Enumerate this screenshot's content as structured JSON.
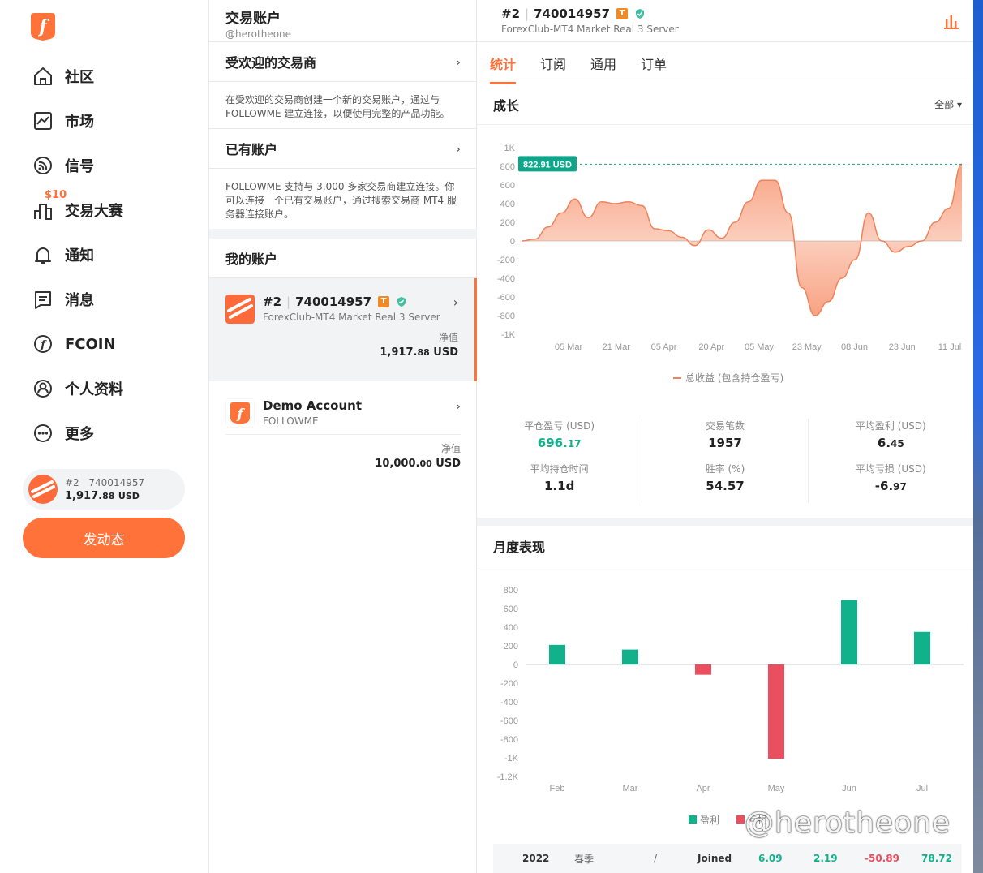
{
  "sidebar": {
    "items": [
      {
        "label": "社区",
        "icon": "home-icon"
      },
      {
        "label": "市场",
        "icon": "chart-icon"
      },
      {
        "label": "信号",
        "icon": "signal-icon"
      },
      {
        "label": "交易大赛",
        "icon": "contest-icon",
        "badge": "$10"
      },
      {
        "label": "通知",
        "icon": "bell-icon"
      },
      {
        "label": "消息",
        "icon": "message-icon"
      },
      {
        "label": "FCOIN",
        "icon": "fcoin-icon"
      },
      {
        "label": "个人资料",
        "icon": "profile-icon"
      },
      {
        "label": "更多",
        "icon": "more-icon"
      }
    ],
    "account_pill": {
      "num": "#2",
      "id": "740014957",
      "balance_main": "1,917.",
      "balance_dec": "88",
      "currency": "USD"
    },
    "post_button": "发动态",
    "accent": "#ff7239"
  },
  "middle": {
    "title": "交易账户",
    "handle": "@herotheone",
    "popular_title": "受欢迎的交易商",
    "popular_desc": "在受欢迎的交易商创建一个新的交易账户，通过与 FOLLOWME 建立连接，以便使用完整的产品功能。",
    "existing_title": "已有账户",
    "existing_desc": "FOLLOWME 支持与 3,000 多家交易商建立连接。你可以连接一个已有交易账户，通过搜索交易商 MT4 服务器连接账户。",
    "my_accounts_title": "我的账户",
    "accounts": [
      {
        "num": "#2",
        "id": "740014957",
        "server": "ForexClub-MT4 Market Real 3 Server",
        "equity_label": "净值",
        "equity_main": "1,917.",
        "equity_dec": "88",
        "currency": "USD",
        "badge": "T"
      },
      {
        "name": "Demo Account",
        "server": "FOLLOWME",
        "equity_label": "净值",
        "equity_main": "10,000.",
        "equity_dec": "00",
        "currency": "USD"
      }
    ]
  },
  "right": {
    "num": "#2",
    "id": "740014957",
    "badge": "T",
    "server": "ForexClub-MT4 Market Real 3 Server",
    "tabs": [
      "统计",
      "订阅",
      "通用",
      "订单"
    ],
    "growth_title": "成长",
    "filter": "全部",
    "stats": [
      {
        "label": "平仓盈亏 (USD)",
        "main": "696.",
        "dec": "17"
      },
      {
        "label": "平均持仓时间",
        "value": "1.1d"
      },
      {
        "label": "交易笔数",
        "value": "1957"
      },
      {
        "label": "胜率 (%)",
        "value": "54.57"
      },
      {
        "label": "平均盈利 (USD)",
        "main": "6.",
        "dec": "45"
      },
      {
        "label": "平均亏损 (USD)",
        "main": "-6.",
        "dec": "97"
      }
    ],
    "monthly_title": "月度表现",
    "table_row": {
      "year": "2022",
      "season": "春季",
      "slash": "/",
      "joined": "Joined",
      "v1": "6.09",
      "v2": "2.19",
      "v3": "-50.89",
      "v4": "78.72"
    }
  },
  "watermark": "@herotheone",
  "chart_data": [
    {
      "type": "area",
      "title": "成长",
      "x": [
        "05 Mar",
        "21 Mar",
        "05 Apr",
        "20 Apr",
        "05 May",
        "23 May",
        "08 Jun",
        "23 Jun",
        "11 Jul"
      ],
      "yticks": [
        "1K",
        "800",
        "600",
        "400",
        "200",
        "0",
        "-200",
        "-400",
        "-600",
        "-800",
        "-1K"
      ],
      "ylim": [
        -1000,
        1000
      ],
      "series": [
        {
          "name": "总收益 (包含持仓盈亏)",
          "values": [
            0,
            20,
            150,
            300,
            450,
            250,
            420,
            400,
            420,
            380,
            130,
            110,
            40,
            -50,
            120,
            30,
            200,
            420,
            650,
            650,
            300,
            -500,
            -800,
            -650,
            -400,
            -200,
            300,
            0,
            -120,
            -60,
            0,
            200,
            350,
            823
          ]
        }
      ],
      "marker_label": "822.91 USD",
      "line_color": "#f0825a"
    },
    {
      "type": "bar",
      "title": "月度表现",
      "categories": [
        "Feb",
        "Mar",
        "Apr",
        "May",
        "Jun",
        "Jul"
      ],
      "yticks": [
        "800",
        "600",
        "400",
        "200",
        "0",
        "-200",
        "-400",
        "-600",
        "-800",
        "-1K",
        "-1.2K"
      ],
      "ylim": [
        -1200,
        800
      ],
      "values": [
        210,
        160,
        -110,
        -1010,
        690,
        350
      ],
      "legend": [
        "盈利",
        "亏损"
      ],
      "pos_color": "#10b18b",
      "neg_color": "#e94f5f"
    }
  ]
}
